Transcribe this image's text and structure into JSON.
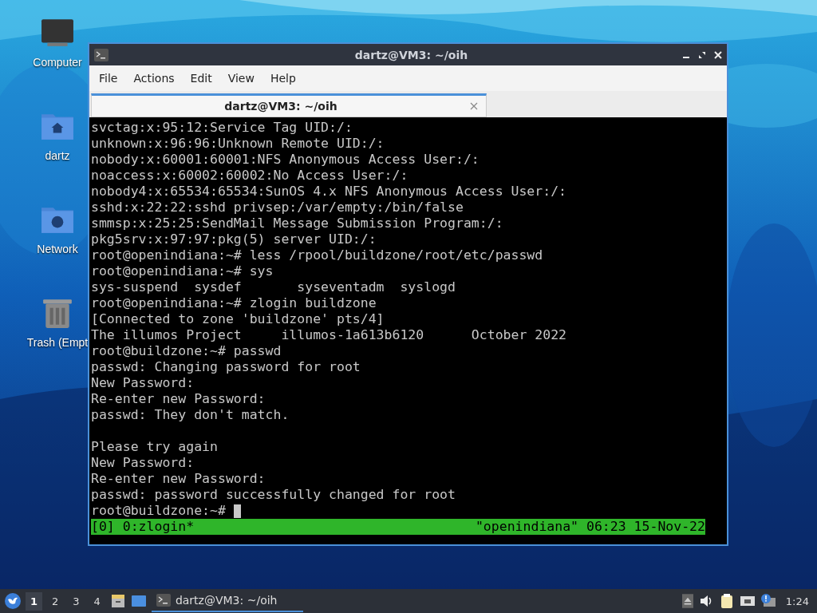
{
  "desktop_icons": [
    {
      "kind": "computer",
      "label": "Computer"
    },
    {
      "kind": "home",
      "label": "dartz"
    },
    {
      "kind": "network",
      "label": "Network"
    },
    {
      "kind": "trash",
      "label": "Trash (Empt"
    }
  ],
  "window": {
    "title": "dartz@VM3: ~/oih",
    "menu": [
      "File",
      "Actions",
      "Edit",
      "View",
      "Help"
    ],
    "tabs": [
      {
        "label": "dartz@VM3: ~/oih",
        "selected": true
      }
    ],
    "terminal": {
      "lines": [
        "svctag:x:95:12:Service Tag UID:/:",
        "unknown:x:96:96:Unknown Remote UID:/:",
        "nobody:x:60001:60001:NFS Anonymous Access User:/:",
        "noaccess:x:60002:60002:No Access User:/:",
        "nobody4:x:65534:65534:SunOS 4.x NFS Anonymous Access User:/:",
        "sshd:x:22:22:sshd privsep:/var/empty:/bin/false",
        "smmsp:x:25:25:SendMail Message Submission Program:/:",
        "pkg5srv:x:97:97:pkg(5) server UID:/:",
        "root@openindiana:~# less /rpool/buildzone/root/etc/passwd",
        "root@openindiana:~# sys",
        "sys-suspend  sysdef       syseventadm  syslogd",
        "root@openindiana:~# zlogin buildzone",
        "[Connected to zone 'buildzone' pts/4]",
        "The illumos Project     illumos-1a613b6120      October 2022",
        "root@buildzone:~# passwd",
        "passwd: Changing password for root",
        "New Password:",
        "Re-enter new Password:",
        "passwd: They don't match.",
        {
          "text": "Please try again",
          "blank_line_before": true
        },
        "New Password:",
        "Re-enter new Password:",
        "passwd: password successfully changed for root",
        "root@buildzone:~# "
      ],
      "cursor": true,
      "status_left": "[0] 0:zlogin*",
      "status_right": "\"openindiana\" 06:23 15-Nov-22"
    }
  },
  "taskbar": {
    "workspaces": [
      {
        "label": "1",
        "selected": true
      },
      {
        "label": "2",
        "selected": false
      },
      {
        "label": "3",
        "selected": false
      },
      {
        "label": "4",
        "selected": false
      }
    ],
    "task": "dartz@VM3: ~/oih",
    "clock": "1:24"
  }
}
